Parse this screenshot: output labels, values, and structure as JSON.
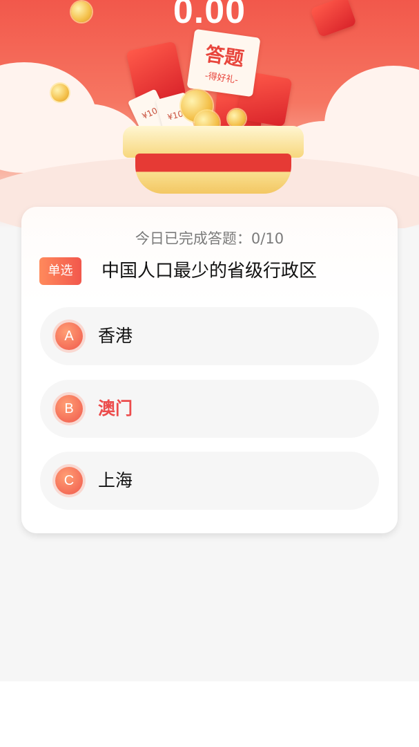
{
  "header": {
    "balance": "0.00",
    "banner_title": "答题",
    "banner_subtitle": "-得好礼-",
    "coupon_label": "¥10"
  },
  "quiz": {
    "progress_text": "今日已完成答题：0/10",
    "type_badge": "单选",
    "question": "中国人口最少的省级行政区",
    "options": [
      {
        "letter": "A",
        "text": "香港"
      },
      {
        "letter": "B",
        "text": "澳门",
        "selected": true
      },
      {
        "letter": "C",
        "text": "上海"
      }
    ]
  },
  "colors": {
    "accent": "#f2574c",
    "selected_text": "#ec4c4c",
    "hero_top": "#f2584b",
    "page_bg": "#f6f6f6"
  },
  "icons": [
    "coin-icon",
    "red-envelope-icon",
    "gift-basket-icon",
    "coupon-icon"
  ]
}
